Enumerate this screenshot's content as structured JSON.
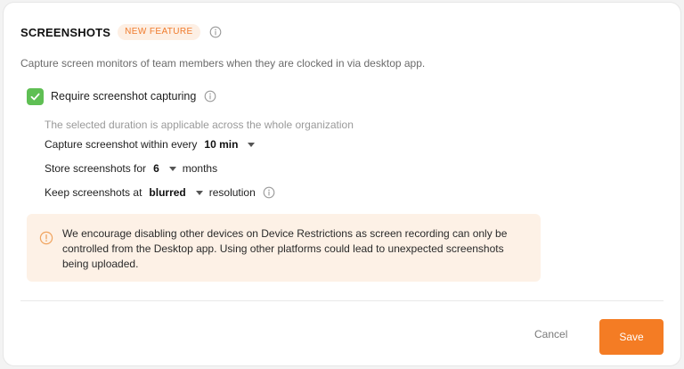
{
  "header": {
    "title": "SCREENSHOTS",
    "badge": "NEW FEATURE",
    "info_icon": "info-circle-icon"
  },
  "description": "Capture screen monitors of team members when they are clocked in via desktop app.",
  "require_capture": {
    "label": "Require screenshot capturing",
    "checked": true,
    "check_color": "#5fbf54"
  },
  "note": "The selected duration is applicable across the whole organization",
  "settings": {
    "interval": {
      "prefix": "Capture screenshot within every",
      "value": "10 min"
    },
    "retention": {
      "prefix": "Store screenshots for",
      "value": "6",
      "suffix": "months"
    },
    "resolution": {
      "prefix": "Keep screenshots at",
      "value": "blurred",
      "suffix": "resolution"
    }
  },
  "alert": {
    "icon": "warning-circle-icon",
    "text": "We encourage disabling other devices on Device Restrictions as screen recording can only be controlled from the Desktop app. Using other platforms could lead to unexpected screenshots being uploaded."
  },
  "footer": {
    "cancel_label": "Cancel",
    "save_label": "Save",
    "accent_color": "#f47c24"
  }
}
